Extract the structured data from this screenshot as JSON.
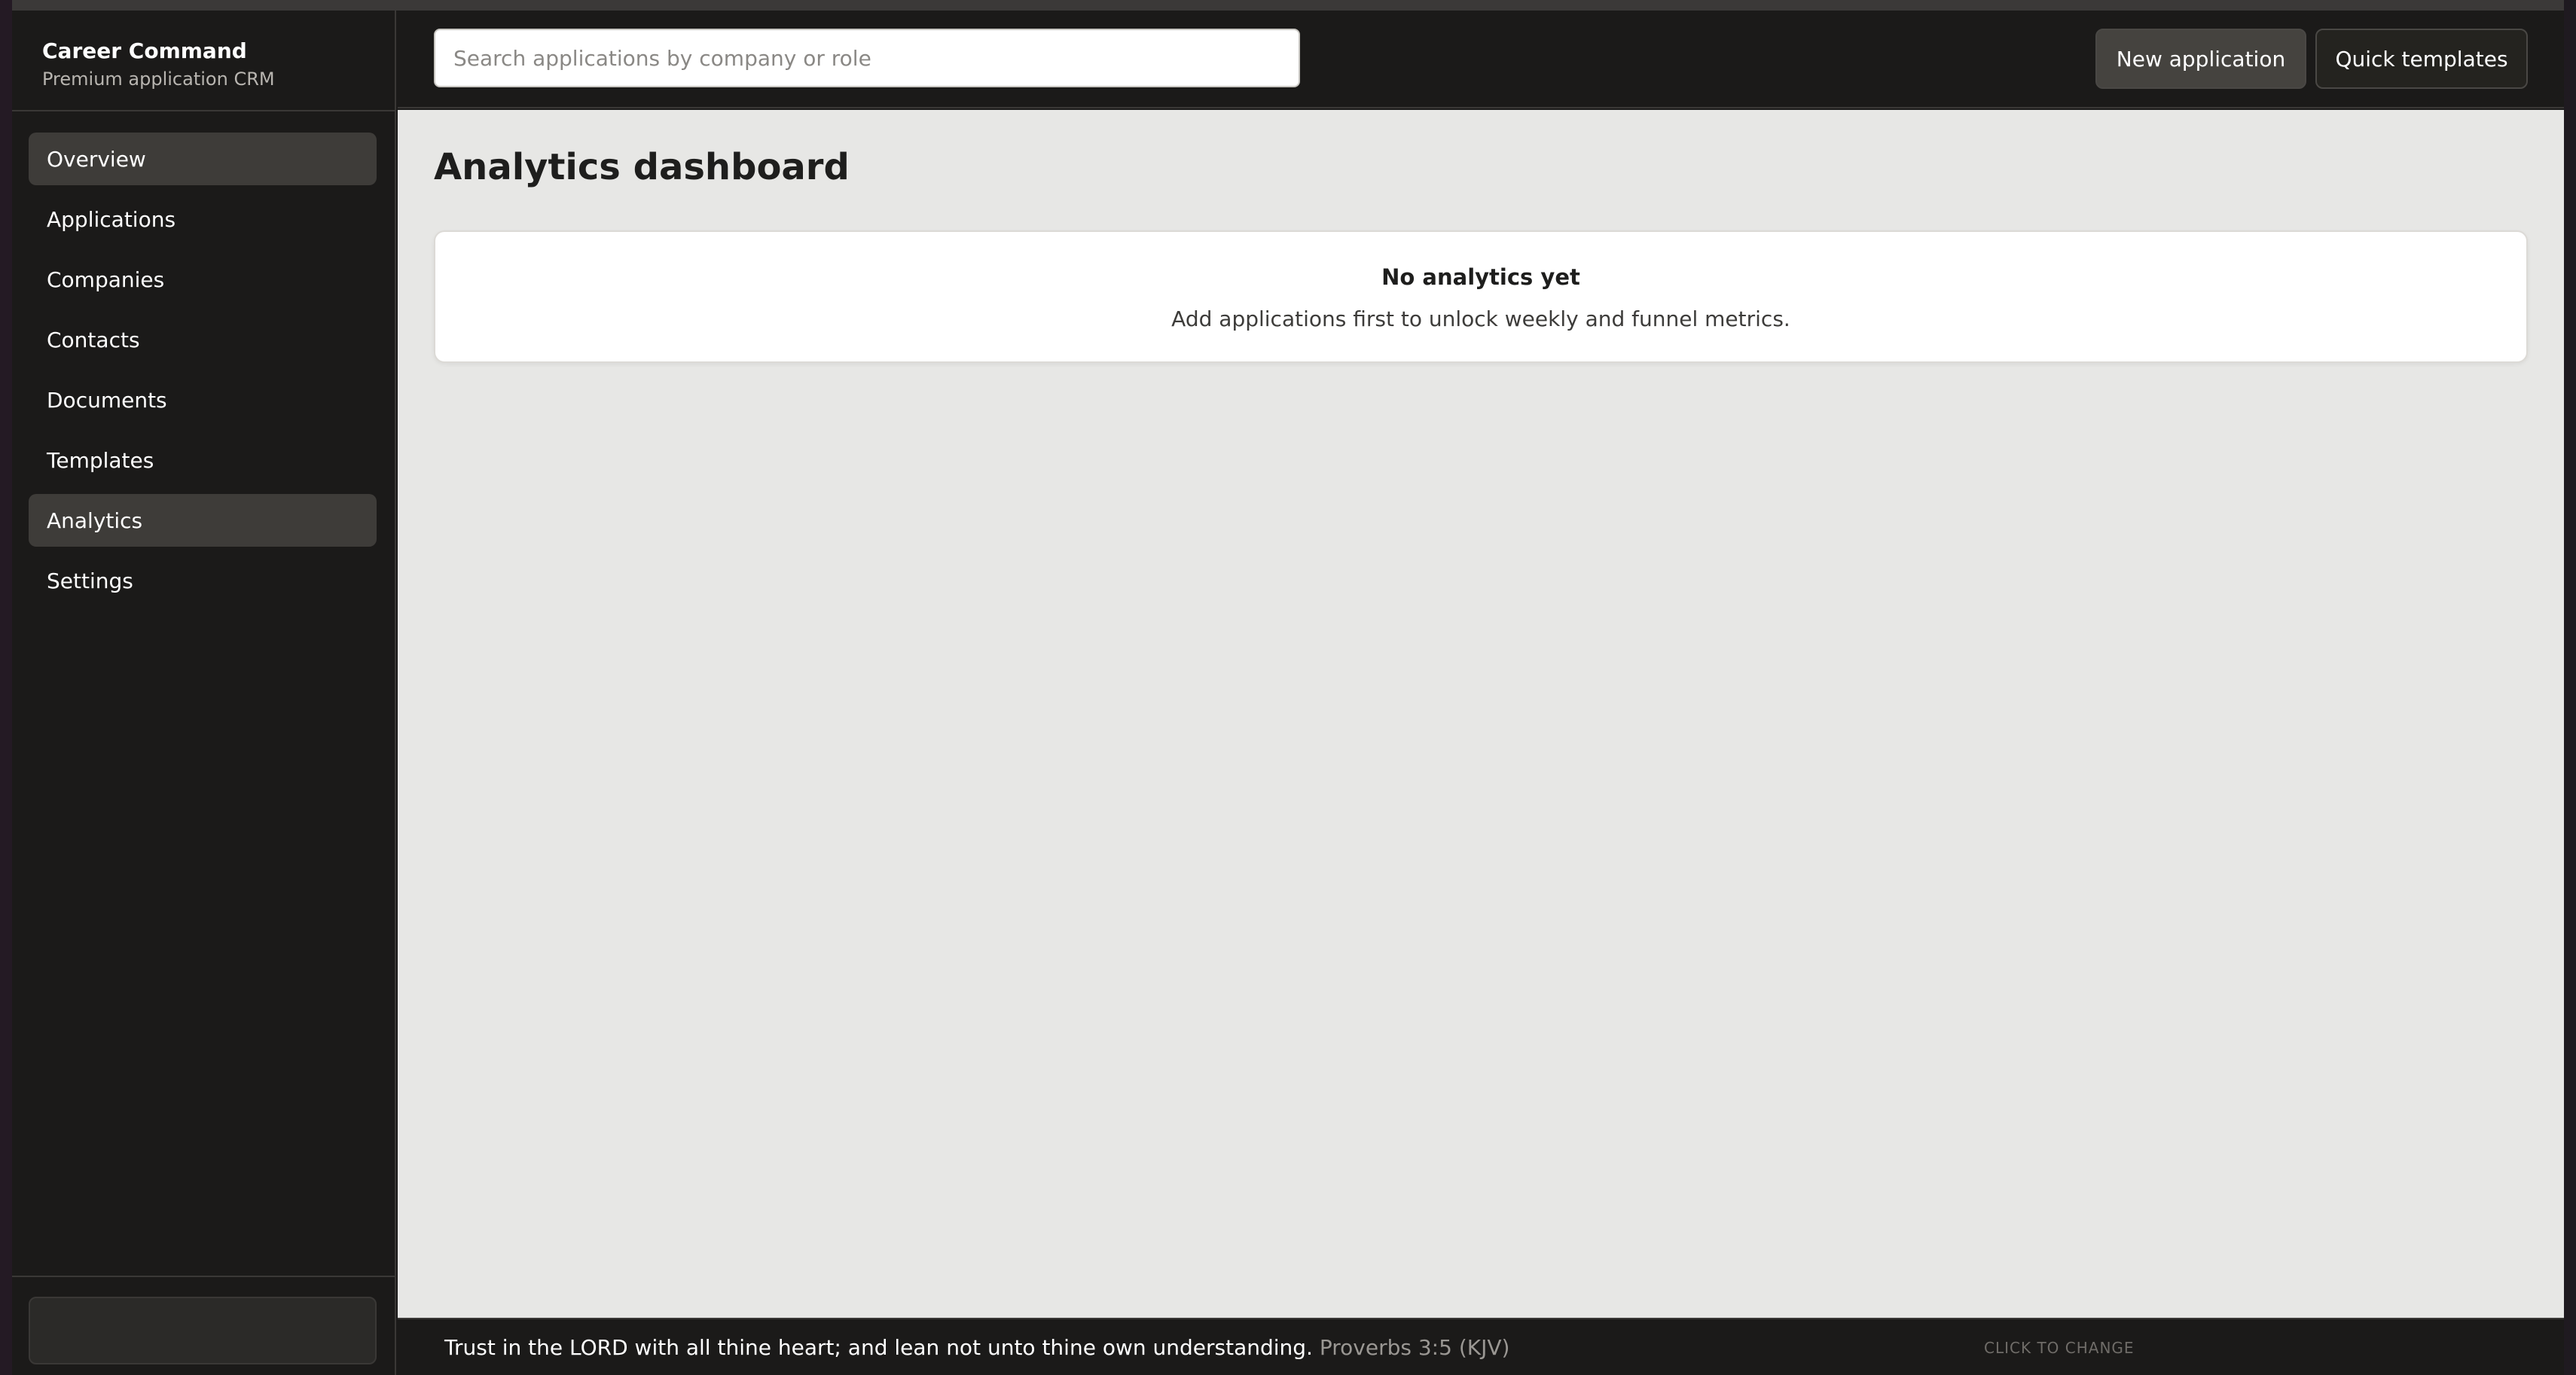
{
  "brand": {
    "title": "Career Command",
    "subtitle": "Premium application CRM"
  },
  "sidebar": {
    "items": [
      {
        "label": "Overview",
        "active": true
      },
      {
        "label": "Applications",
        "active": false
      },
      {
        "label": "Companies",
        "active": false
      },
      {
        "label": "Contacts",
        "active": false
      },
      {
        "label": "Documents",
        "active": false
      },
      {
        "label": "Templates",
        "active": false
      },
      {
        "label": "Analytics",
        "active": true
      },
      {
        "label": "Settings",
        "active": false
      }
    ]
  },
  "search": {
    "placeholder": "Search applications by company or role",
    "value": ""
  },
  "toolbar": {
    "new_application": "New application",
    "quick_templates": "Quick templates"
  },
  "main": {
    "title": "Analytics dashboard",
    "empty_state": {
      "title": "No analytics yet",
      "text": "Add applications first to unlock weekly and funnel metrics."
    }
  },
  "footer": {
    "verse": "Trust in the LORD with all thine heart; and lean not unto thine own understanding.",
    "reference": "Proverbs 3:5 (KJV)",
    "action": "CLICK TO CHANGE"
  },
  "colors": {
    "sidebar_bg": "#1b1a19",
    "active_item_bg": "#3e3c39",
    "main_bg": "#e7e7e5",
    "card_bg": "#ffffff"
  }
}
